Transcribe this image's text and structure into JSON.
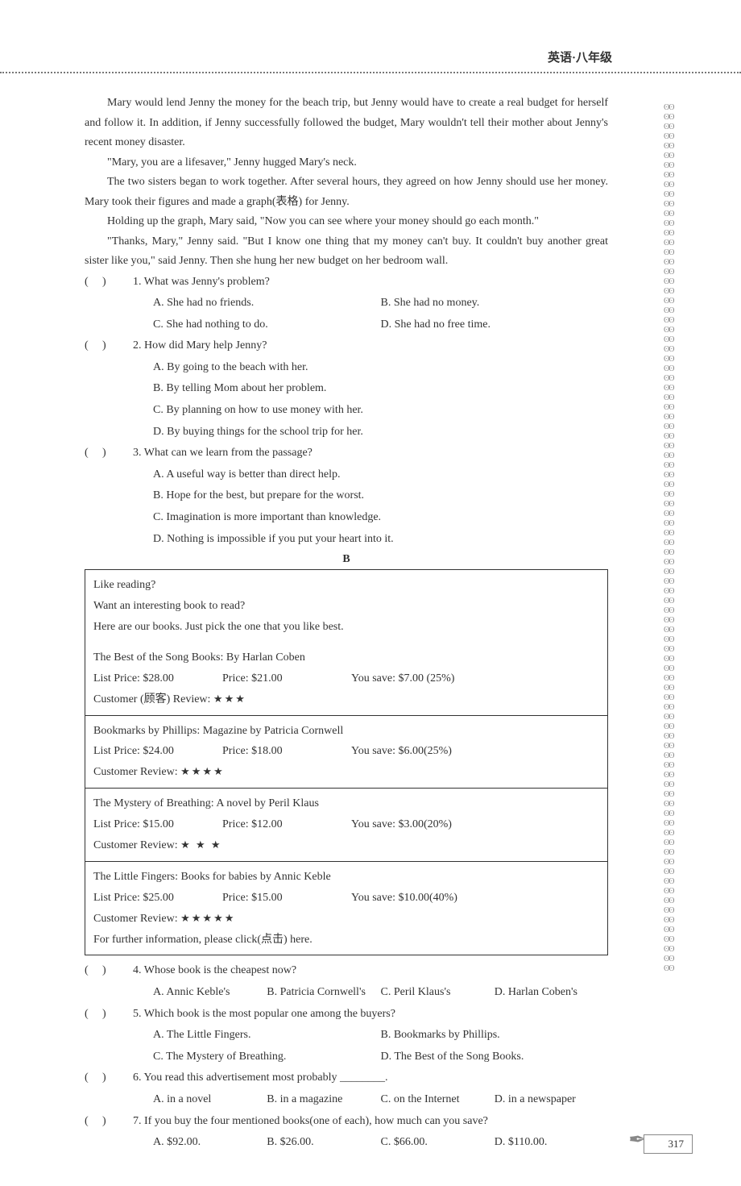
{
  "header": {
    "title": "英语·八年级"
  },
  "passage": {
    "p1": "Mary would lend Jenny the money for the beach trip, but Jenny would have to create a real budget for herself and follow it. In addition, if Jenny successfully followed the budget, Mary wouldn't tell their mother about Jenny's recent money disaster.",
    "p2": "\"Mary, you are a lifesaver,\" Jenny hugged Mary's neck.",
    "p3": "The two sisters began to work together. After several hours, they agreed on how Jenny should use her money. Mary took their figures and made a graph(表格) for Jenny.",
    "p4": "Holding up the graph, Mary said, \"Now you can see where your money should go each month.\"",
    "p5": "\"Thanks, Mary,\" Jenny said. \"But I know one thing that my money can't buy. It couldn't buy another great sister like you,\" said Jenny. Then she hung her new budget on her bedroom wall."
  },
  "questions_a": [
    {
      "num": "1. What was Jenny's problem?",
      "opts": [
        "A. She had no friends.",
        "B. She had no money.",
        "C. She had nothing to do.",
        "D. She had no free time."
      ],
      "layout": "two"
    },
    {
      "num": "2. How did Mary help Jenny?",
      "opts": [
        "A. By going to the beach with her.",
        "B. By telling Mom about her problem.",
        "C. By planning on how to use money with her.",
        "D. By buying things for the school trip for her."
      ],
      "layout": "one"
    },
    {
      "num": "3. What can we learn from the passage?",
      "opts": [
        "A. A useful way is better than direct help.",
        "B. Hope for the best, but prepare for the worst.",
        "C. Imagination is more important than knowledge.",
        "D. Nothing is impossible if you put your heart into it."
      ],
      "layout": "one"
    }
  ],
  "section_b": "B",
  "books": {
    "intro": {
      "l1": "Like reading?",
      "l2": "Want an interesting book to read?",
      "l3": "Here are our books. Just pick the one that you like best."
    },
    "list": [
      {
        "title": "The Best of the Song Books: By Harlan Coben",
        "list_price": "List Price: $28.00",
        "price": "Price: $21.00",
        "save": "You save: $7.00 (25%)",
        "review_label": "Customer (顾客) Review:",
        "stars": "★★★"
      },
      {
        "title": "Bookmarks by Phillips: Magazine by Patricia Cornwell",
        "list_price": "List Price: $24.00",
        "price": "Price: $18.00",
        "save": "You save: $6.00(25%)",
        "review_label": "Customer Review:",
        "stars": "★★★★"
      },
      {
        "title": "The Mystery of Breathing: A novel by Peril Klaus",
        "list_price": "List Price: $15.00",
        "price": "Price: $12.00",
        "save": "You save: $3.00(20%)",
        "review_label": "Customer Review:",
        "stars": "★ ★ ★"
      },
      {
        "title": "The Little Fingers: Books for babies by Annic Keble",
        "list_price": "List Price: $25.00",
        "price": "Price: $15.00",
        "save": "You save: $10.00(40%)",
        "review_label": "Customer Review:",
        "stars": "★★★★★",
        "extra": "For further information, please click(点击) here."
      }
    ]
  },
  "questions_b": [
    {
      "num": "4. Whose book is the cheapest now?",
      "opts": [
        "A. Annic Keble's",
        "B. Patricia Cornwell's",
        "C. Peril Klaus's",
        "D. Harlan Coben's"
      ],
      "layout": "four"
    },
    {
      "num": "5. Which book is the most popular one among the buyers?",
      "opts": [
        "A. The Little Fingers.",
        "B. Bookmarks by Phillips.",
        "C. The Mystery of Breathing.",
        "D. The Best of the Song Books."
      ],
      "layout": "two"
    },
    {
      "num": "6. You read this advertisement most probably ________.",
      "opts": [
        "A. in a novel",
        "B. in a magazine",
        "C. on the Internet",
        "D. in a newspaper"
      ],
      "layout": "four"
    },
    {
      "num": "7. If you buy the four mentioned books(one of each), how much can you save?",
      "opts": [
        "A. $92.00.",
        "B. $26.00.",
        "C. $66.00.",
        "D. $110.00."
      ],
      "layout": "four"
    }
  ],
  "page_number": "317"
}
